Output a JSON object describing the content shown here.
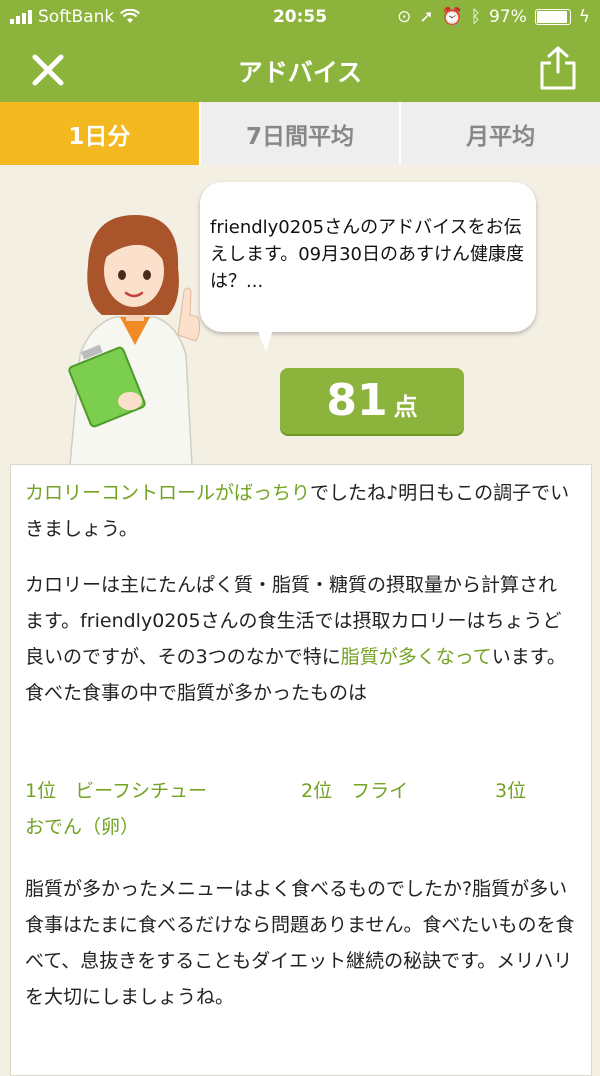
{
  "status_bar": {
    "carrier": "SoftBank",
    "time": "20:55",
    "battery": "97%"
  },
  "nav": {
    "title": "アドバイス"
  },
  "tabs": [
    {
      "label": "1日分",
      "active": true
    },
    {
      "label": "7日間平均",
      "active": false
    },
    {
      "label": "月平均",
      "active": false
    }
  ],
  "bubble": {
    "text": "friendly0205さんのアドバイスをお伝えします。09月30日のあすけん健康度は？..."
  },
  "score": {
    "value": "81",
    "unit": "点"
  },
  "advice": {
    "p1_highlight": "カロリーコントロールがばっちり",
    "p1_rest": "でしたね♪明日もこの調子でいきましょう。",
    "p2_part1": "カロリーは主にたんぱく質・脂質・糖質の摂取量から計算されます。friendly0205さんの食生活では摂取カロリーはちょうど良いのですが、その3つのなかで特に",
    "p2_highlight": "脂質が多くなって",
    "p2_part2": "います。食べた食事の中で脂質が多かったものは",
    "ranking": [
      {
        "rank": "1位",
        "item": "ビーフシチュー"
      },
      {
        "rank": "2位",
        "item": "フライ"
      },
      {
        "rank": "3位",
        "item": "おでん（卵）"
      }
    ],
    "p3": "脂質が多かったメニューはよく食べるものでしたか?脂質が多い食事はたまに食べるだけなら問題ありません。食べたいものを食べて、息抜きをすることもダイエット継続の秘訣です。メリハリを大切にしましょうね。"
  },
  "colors": {
    "header_green": "#8cb43c",
    "active_tab": "#f4b820",
    "highlight_green": "#72a323",
    "background": "#f3efe3"
  }
}
